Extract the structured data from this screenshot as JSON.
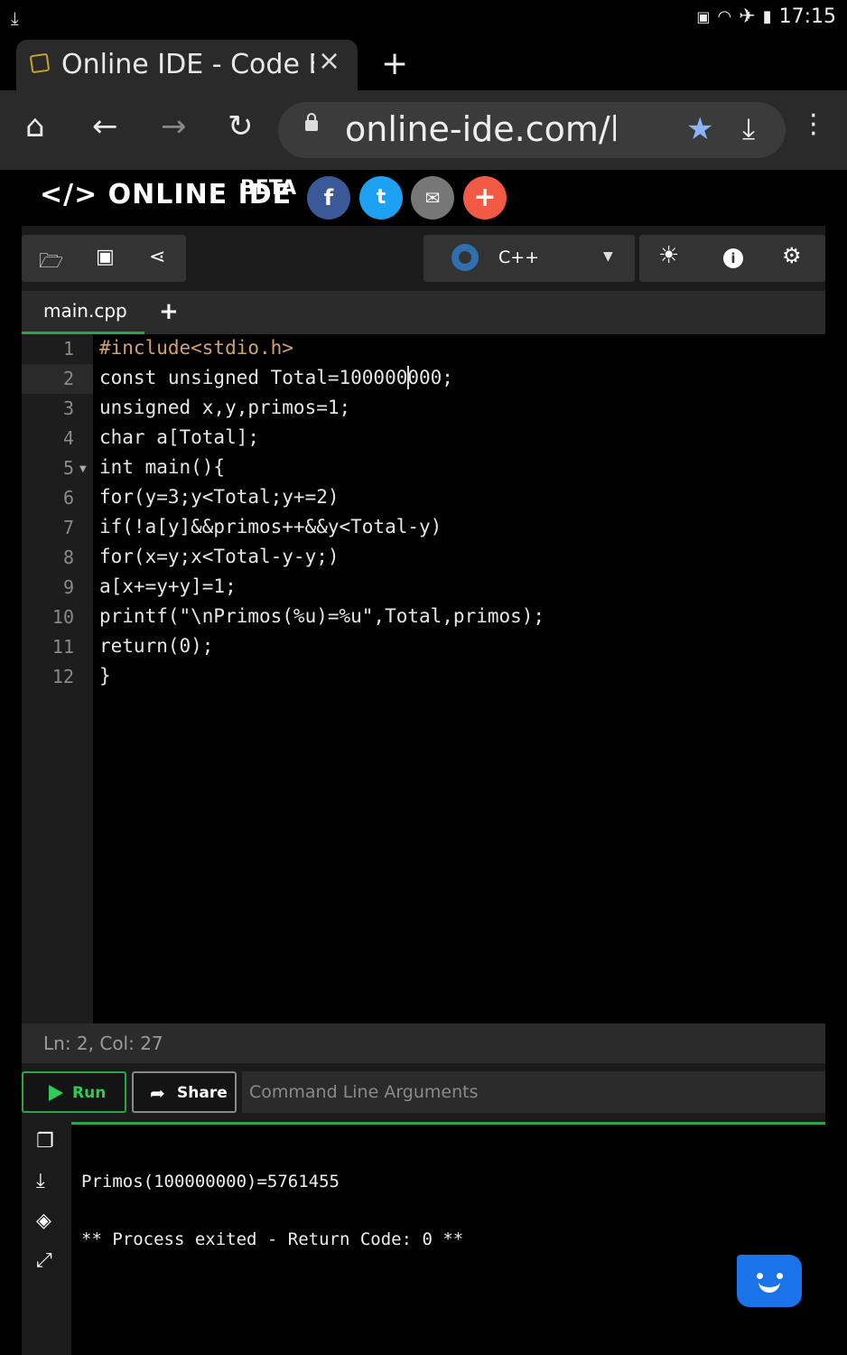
{
  "status_bar": {
    "time": "17:15"
  },
  "browser": {
    "tab_title": "Online IDE - Code E",
    "url": "online-ide.com/lSOyV"
  },
  "site": {
    "logo": "</> ONLINE IDE",
    "beta": "BETA"
  },
  "toolbar": {
    "language": "C++"
  },
  "editor": {
    "file_tab": "main.cpp",
    "line_numbers": [
      "1",
      "2",
      "3",
      "4",
      "5",
      "6",
      "7",
      "8",
      "9",
      "10",
      "11",
      "12"
    ],
    "lines": [
      "#include<stdio.h>",
      "const unsigned Total=100000000;",
      "unsigned x,y,primos=1;",
      "char a[Total];",
      "int main(){",
      "for(y=3;y<Total;y+=2)",
      "if(!a[y]&&primos++&&y<Total-y)",
      "for(x=y;x<Total-y-y;)",
      "a[x+=y+y]=1;",
      "printf(\"\\nPrimos(%u)=%u\",Total,primos);",
      "return(0);",
      "}"
    ],
    "cursor_status": "Ln: 2,  Col: 27"
  },
  "actions": {
    "run_label": "Run",
    "share_label": "Share",
    "args_placeholder": "Command Line Arguments"
  },
  "output": {
    "line1": "Primos(100000000)=5761455",
    "line2": "** Process exited - Return Code: 0 **"
  },
  "colors": {
    "accent_green": "#27a844",
    "facebook": "#3b5998",
    "twitter": "#1da1f2",
    "plus": "#f25a46",
    "chat_blue": "#1a73e8"
  }
}
